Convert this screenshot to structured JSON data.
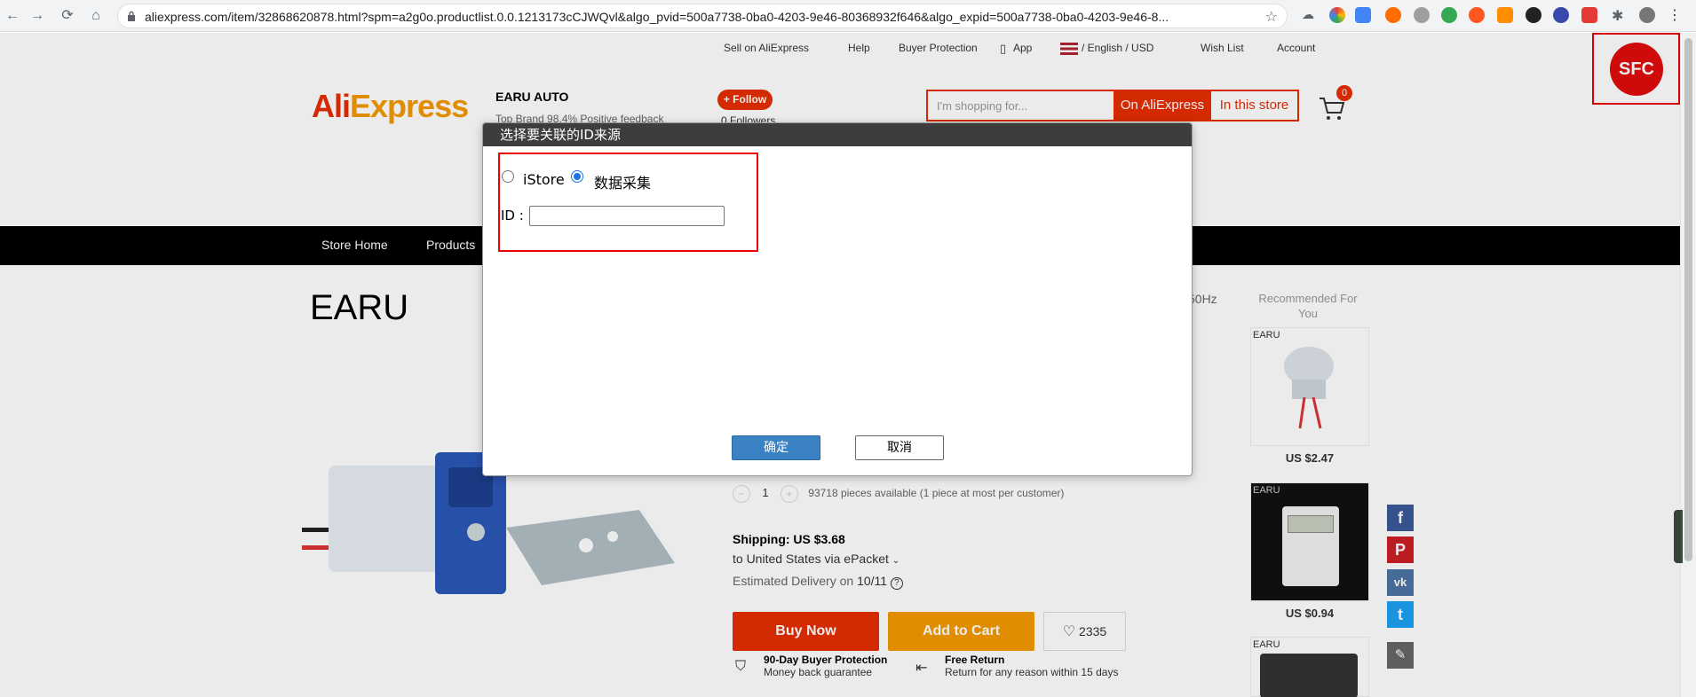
{
  "browser": {
    "url": "aliexpress.com/item/32868620878.html?spm=a2g0o.productlist.0.0.1213173cCJWQvl&algo_pvid=500a7738-0ba0-4203-9e46-80368932f646&algo_expid=500a7738-0ba0-4203-9e46-8...",
    "back_icon": "←",
    "forward_icon": "→",
    "reload_icon": "⟳",
    "home_icon": "⌂",
    "star_icon": "☆",
    "menu_icon": "⋮"
  },
  "topbar": {
    "sell": "Sell on AliExpress",
    "help": "Help",
    "buyer_protection": "Buyer Protection",
    "app": "App",
    "language": "/ English /  USD",
    "wish_list": "Wish List",
    "account": "Account"
  },
  "header": {
    "logo_a": "Ali",
    "logo_b": "Express",
    "store_name": "EARU AUTO",
    "store_sub": "Top Brand   98.4% Positive feedback",
    "follow": "+ Follow",
    "followers": "0 Followers",
    "search_placeholder": "I'm shopping for...",
    "search_on": "On AliExpress",
    "search_store": "In this store",
    "cart_count": "0"
  },
  "sfc": {
    "label": "SFC"
  },
  "store_nav": {
    "home": "Store Home",
    "products": "Products"
  },
  "product": {
    "brand": "EARU",
    "spec_fragment": "50Hz",
    "qty_minus": "−",
    "qty_value": "1",
    "qty_plus": "+",
    "qty_note": "93718 pieces available (1 piece at most per customer)",
    "shipping": "Shipping: US $3.68",
    "ship_to": "to United States via ePacket",
    "delivery_label": "Estimated Delivery on ",
    "delivery_date": "10/11",
    "buy_now": "Buy Now",
    "add_to_cart": "Add to Cart",
    "wish_count": "2335",
    "guarantee1_title": "90-Day Buyer Protection",
    "guarantee1_sub": "Money back guarantee",
    "guarantee2_title": "Free Return",
    "guarantee2_sub": "Return for any reason within 15 days"
  },
  "recommended": {
    "title": "Recommended For You",
    "items": [
      {
        "label": "EARU",
        "price": "US $2.47"
      },
      {
        "label": "EARU",
        "price": "US $0.94"
      },
      {
        "label": "EARU",
        "price": ""
      }
    ]
  },
  "social": {
    "facebook": "f",
    "pinterest": "P",
    "vk": "vk",
    "twitter": "t",
    "edit": "✎"
  },
  "dialog": {
    "title": "选择要关联的ID来源",
    "option_istore": "iStore",
    "option_collect": "数据采集",
    "selected": "数据采集",
    "id_label": "ID :",
    "id_value": "",
    "ok": "确定",
    "cancel": "取消"
  },
  "colors": {
    "accent": "#e62e04",
    "orange": "#f49a02",
    "highlight": "#ee0000",
    "dialog_ok": "#3b82c4"
  }
}
